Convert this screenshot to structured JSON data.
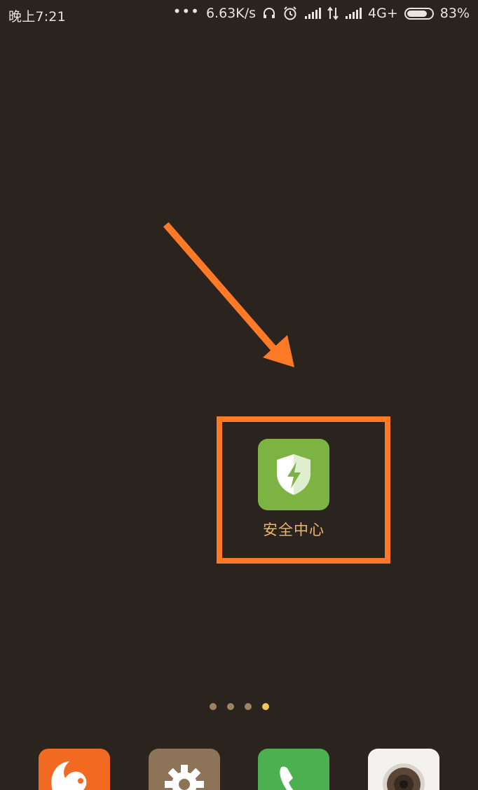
{
  "status_bar": {
    "time": "晚上7:21",
    "dots": "•••",
    "net_speed": "6.63K/s",
    "network_type": "4G+",
    "battery_percent": "83%",
    "battery_level": 0.83,
    "icons": [
      "headphone-icon",
      "alarm-icon",
      "signal-icon",
      "data-arrows-icon",
      "signal-icon",
      "battery-icon"
    ]
  },
  "home": {
    "highlighted_app": {
      "label": "安全中心",
      "icon": "shield-lightning-icon",
      "color": "#7cb342"
    },
    "annotation": {
      "color": "#ff7a26",
      "type": "arrow-and-box"
    },
    "page_indicator": {
      "total": 4,
      "active_index": 3
    }
  },
  "dock": {
    "apps": [
      {
        "name": "uc-browser",
        "icon": "squirrel-icon",
        "color": "#f26a22"
      },
      {
        "name": "settings",
        "icon": "gear-icon",
        "color": "#8d7358"
      },
      {
        "name": "phone",
        "icon": "phone-icon",
        "color": "#4caf50"
      },
      {
        "name": "camera",
        "icon": "camera-lens-icon",
        "color": "#f4f2ef"
      }
    ]
  }
}
